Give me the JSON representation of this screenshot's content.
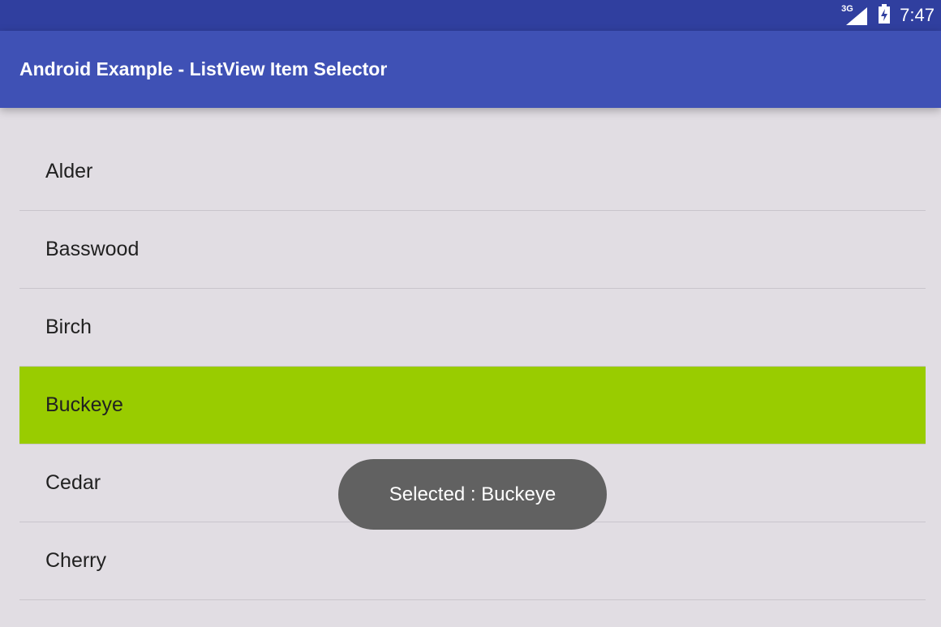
{
  "status_bar": {
    "network_label": "3G",
    "time": "7:47",
    "icons": [
      "signal-icon",
      "battery-charging-icon"
    ]
  },
  "app_bar": {
    "title": "Android Example - ListView Item Selector"
  },
  "list": {
    "items": [
      {
        "label": "Alder",
        "selected": false
      },
      {
        "label": "Basswood",
        "selected": false
      },
      {
        "label": "Birch",
        "selected": false
      },
      {
        "label": "Buckeye",
        "selected": true
      },
      {
        "label": "Cedar",
        "selected": false
      },
      {
        "label": "Cherry",
        "selected": false
      }
    ]
  },
  "toast": {
    "text": "Selected : Buckeye"
  },
  "colors": {
    "status_bar": "#303f9f",
    "app_bar": "#3f51b5",
    "background": "#e1dde3",
    "selected_item": "#99cc00",
    "toast": "#616161"
  }
}
